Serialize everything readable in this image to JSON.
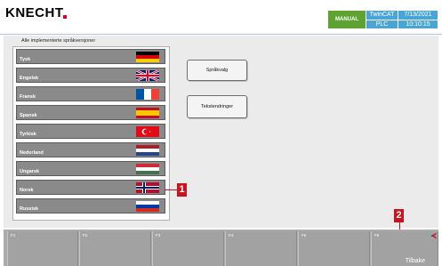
{
  "header": {
    "logo": "KNECHT",
    "mode": "MANUAL",
    "twincat": "TwinCAT",
    "plc": "PLC",
    "date": "7/13/2021",
    "time": "10:10:15"
  },
  "languages": {
    "title": "Alle implementerte språkversjoner",
    "items": [
      {
        "label": "Tysk",
        "flag": "germany-flag-icon"
      },
      {
        "label": "Engelsk",
        "flag": "uk-flag-icon"
      },
      {
        "label": "Fransk",
        "flag": "france-flag-icon"
      },
      {
        "label": "Spansk",
        "flag": "spain-flag-icon"
      },
      {
        "label": "Tyrkisk",
        "flag": "turkey-flag-icon"
      },
      {
        "label": "Nederland",
        "flag": "netherlands-flag-icon"
      },
      {
        "label": "Ungarsk",
        "flag": "hungary-flag-icon"
      },
      {
        "label": "Norsk",
        "flag": "norway-flag-icon"
      },
      {
        "label": "Russisk",
        "flag": "russia-flag-icon"
      }
    ]
  },
  "buttons": {
    "language_select": "Språkvalg",
    "text_changes": "Tekstendringer"
  },
  "callouts": {
    "one": "1",
    "two": "2"
  },
  "function_keys": [
    "F1",
    "F2",
    "F3",
    "F4",
    "F5",
    "F6"
  ],
  "back_label": "Tilbake",
  "colors": {
    "brand_red": "#e2001a",
    "mode_green": "#5ea332",
    "status_blue": "#4aa5d3",
    "callout_red": "#c8141e"
  }
}
